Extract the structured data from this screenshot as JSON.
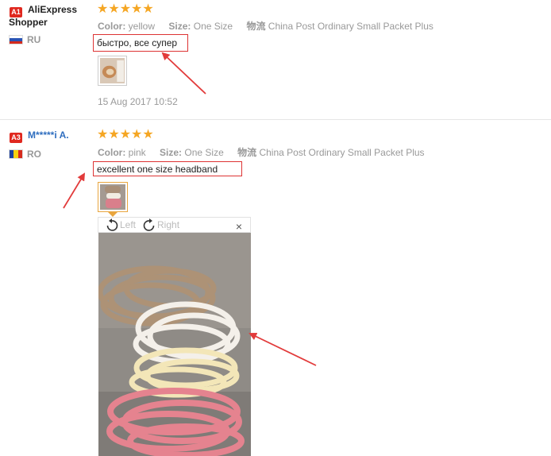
{
  "reviews": [
    {
      "badge": "A1",
      "username_line1": "AliExpress",
      "username_line2": "Shopper",
      "country": "RU",
      "stars": "★★★★★",
      "color_label": "Color:",
      "color_value": "yellow",
      "size_label": "Size:",
      "size_value": "One Size",
      "shipping_label": "物流",
      "shipping_value": "China Post Ordinary Small Packet Plus",
      "feedback": "быстро, все супер",
      "date": "15 Aug 2017 10:52"
    },
    {
      "badge": "A3",
      "username": "M*****i A.",
      "country": "RO",
      "stars": "★★★★★",
      "color_label": "Color:",
      "color_value": "pink",
      "size_label": "Size:",
      "size_value": "One Size",
      "shipping_label": "物流",
      "shipping_value": "China Post Ordinary Small Packet Plus",
      "feedback": "excellent one size headband"
    }
  ],
  "viewer": {
    "rotate_left": "Left",
    "rotate_right": "Right",
    "close": "×"
  },
  "colors": {
    "star": "#f5a623",
    "badge": "#e0281f",
    "annotation": "#e23b3b",
    "highlight": "#e9a63f"
  }
}
